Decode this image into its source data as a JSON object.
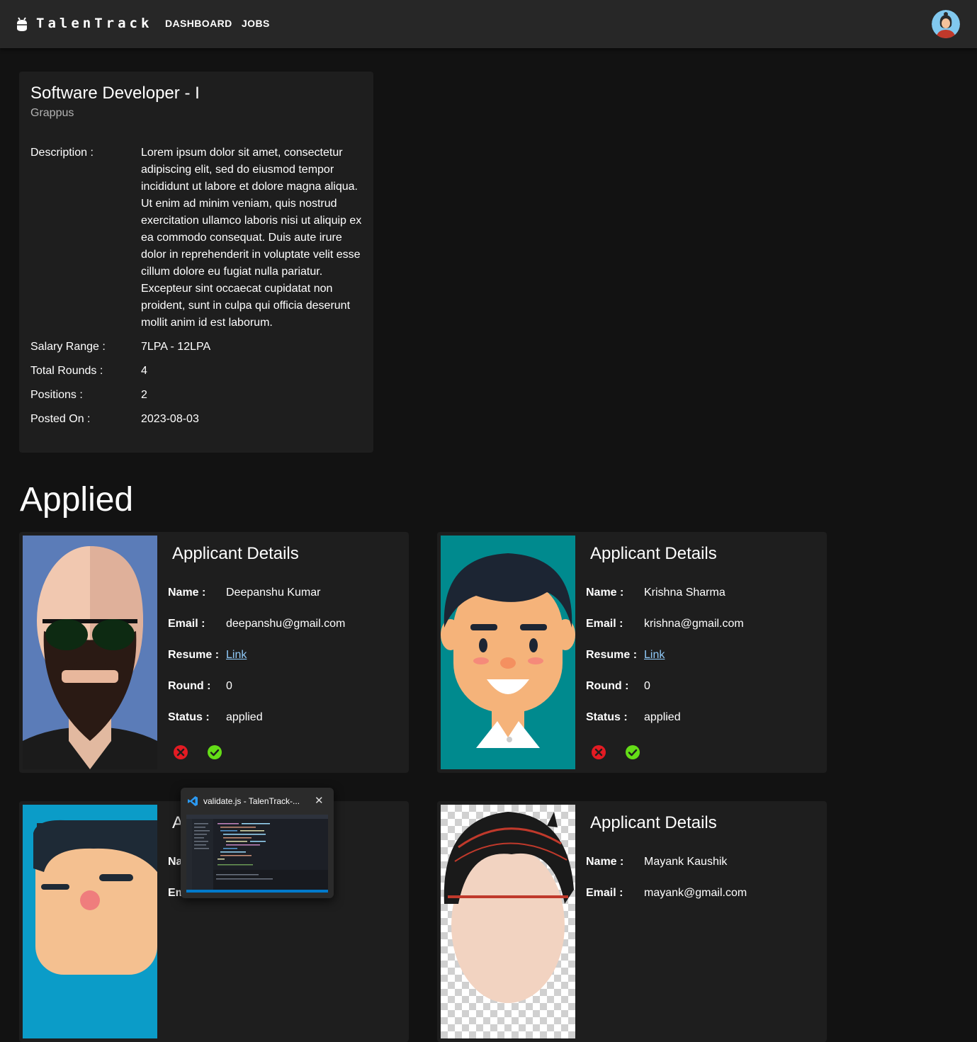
{
  "appbar": {
    "brand": "TalenTrack",
    "nav": [
      "DASHBOARD",
      "JOBS"
    ]
  },
  "job": {
    "title": "Software Developer - I",
    "company": "Grappus",
    "description_label": "Description :",
    "description": "Lorem ipsum dolor sit amet, consectetur adipiscing elit, sed do eiusmod tempor incididunt ut labore et dolore magna aliqua. Ut enim ad minim veniam, quis nostrud exercitation ullamco laboris nisi ut aliquip ex ea commodo consequat. Duis aute irure dolor in reprehenderit in voluptate velit esse cillum dolore eu fugiat nulla pariatur. Excepteur sint occaecat cupidatat non proident, sunt in culpa qui officia deserunt mollit anim id est laborum.",
    "salary_label": "Salary Range :",
    "salary": "7LPA - 12LPA",
    "rounds_label": "Total Rounds :",
    "rounds": "4",
    "positions_label": "Positions :",
    "positions": "2",
    "posted_label": "Posted On :",
    "posted": "2023-08-03"
  },
  "section_title": "Applied",
  "labels": {
    "heading": "Applicant Details",
    "name": "Name :",
    "email": "Email :",
    "resume": "Resume :",
    "round": "Round :",
    "status": "Status :",
    "link": "Link"
  },
  "applicants": [
    {
      "name": "Deepanshu Kumar",
      "email": "deepanshu@gmail.com",
      "round": "0",
      "status": "applied"
    },
    {
      "name": "Krishna Sharma",
      "email": "krishna@gmail.com",
      "round": "0",
      "status": "applied"
    },
    {
      "heading_partial": "A",
      "name_partial": "Na",
      "email_partial": "Em"
    },
    {
      "name": "Mayank Kaushik",
      "email": "mayank@gmail.com"
    }
  ],
  "taskbar_preview": {
    "title": "validate.js - TalenTrack-...",
    "close": "✕"
  },
  "colors": {
    "background": "#121212",
    "card": "#1e1e1e",
    "appbar": "#272727",
    "link": "#90caf9",
    "reject": "#e31b23",
    "accept": "#64dd17"
  }
}
